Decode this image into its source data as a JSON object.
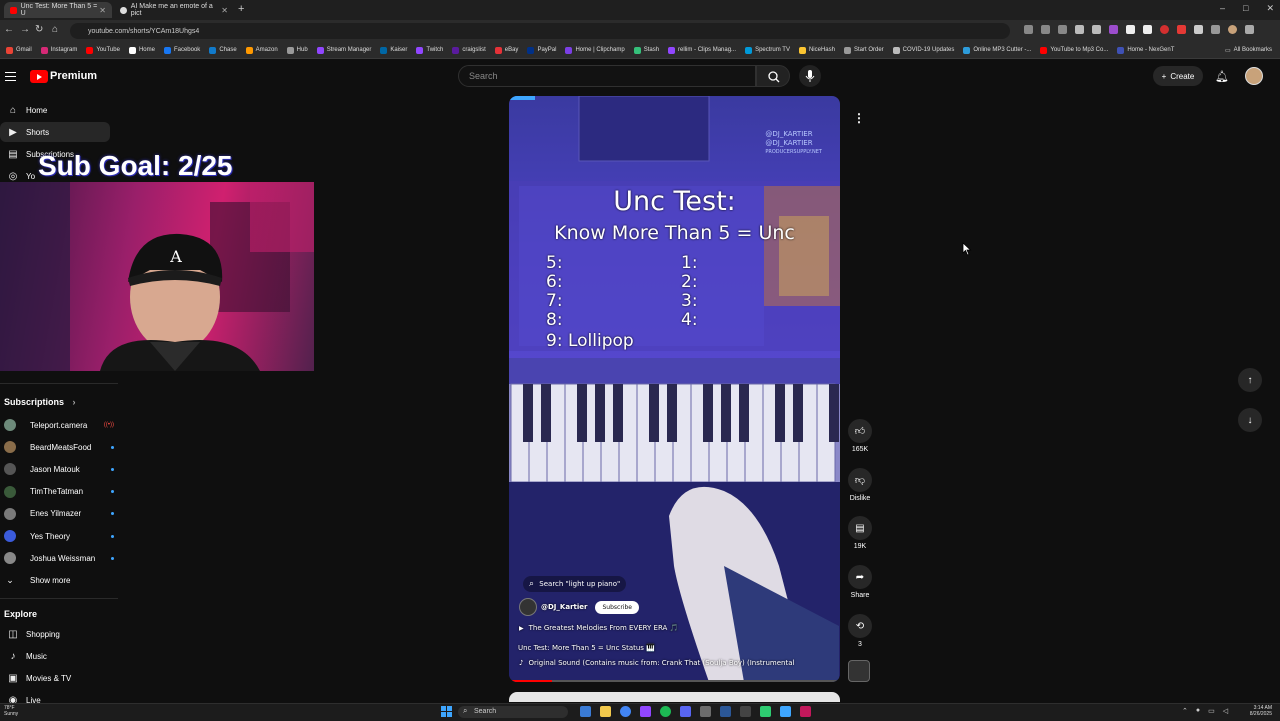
{
  "browser": {
    "tabs": [
      {
        "title": "Unc Test: More Than 5 = U"
      },
      {
        "title": "AI Make me an emote of a pict"
      }
    ],
    "url": "youtube.com/shorts/YCAm18Uhgs4",
    "window_controls": [
      "–",
      "□",
      "✕"
    ]
  },
  "bookmarks": [
    {
      "label": "Gmail",
      "color": "#ea4335"
    },
    {
      "label": "Instagram",
      "color": "#d62976"
    },
    {
      "label": "YouTube",
      "color": "#ff0000"
    },
    {
      "label": "Home",
      "color": "#ffffff"
    },
    {
      "label": "Facebook",
      "color": "#1877f2"
    },
    {
      "label": "Chase",
      "color": "#117aca"
    },
    {
      "label": "Amazon",
      "color": "#ff9900"
    },
    {
      "label": "Hub",
      "color": "#999999"
    },
    {
      "label": "Stream Manager",
      "color": "#9146ff"
    },
    {
      "label": "Kaiser",
      "color": "#0067a5"
    },
    {
      "label": "Twitch",
      "color": "#9146ff"
    },
    {
      "label": "craigslist",
      "color": "#5a1b9e"
    },
    {
      "label": "eBay",
      "color": "#e53238"
    },
    {
      "label": "PayPal",
      "color": "#003087"
    },
    {
      "label": "Home | Clipchamp",
      "color": "#7b3fe4"
    },
    {
      "label": "Stash",
      "color": "#35c07a"
    },
    {
      "label": "rellim - Clips Manag...",
      "color": "#9146ff"
    },
    {
      "label": "Spectrum TV",
      "color": "#0099d8"
    },
    {
      "label": "NiceHash",
      "color": "#fbc531"
    },
    {
      "label": "Start Order",
      "color": "#999999"
    },
    {
      "label": "COVID-19 Updates",
      "color": "#bbbbbb"
    },
    {
      "label": "Online MP3 Cutter -...",
      "color": "#2d9cdb"
    },
    {
      "label": "YouTube to Mp3 Co...",
      "color": "#ff0000"
    },
    {
      "label": "Home - NexGenT",
      "color": "#3f51b5"
    }
  ],
  "bookmarks_all": "All Bookmarks",
  "youtube": {
    "brand": "Premium",
    "search_placeholder": "Search",
    "create_label": "Create"
  },
  "sidebar": {
    "main": [
      {
        "label": "Home",
        "icon": "⌂"
      },
      {
        "label": "Shorts",
        "icon": "▶"
      },
      {
        "label": "Subscriptions",
        "icon": "▤"
      },
      {
        "label": "Yo",
        "icon": "◎"
      }
    ],
    "subscriptions_title": "Subscriptions",
    "subscriptions": [
      {
        "name": "Teleport.camera",
        "color": "#6d8a7a",
        "live": true
      },
      {
        "name": "BeardMeatsFood",
        "color": "#8a6d4a",
        "live": false
      },
      {
        "name": "Jason Matouk",
        "color": "#555555",
        "live": false
      },
      {
        "name": "TimTheTatman",
        "color": "#3a5a3a",
        "live": false
      },
      {
        "name": "Enes Yilmazer",
        "color": "#7a7a7a",
        "live": false
      },
      {
        "name": "Yes Theory",
        "color": "#3b5bdb",
        "live": false
      },
      {
        "name": "Joshua Weissman",
        "color": "#888888",
        "live": false
      }
    ],
    "show_more": "Show more",
    "explore_title": "Explore",
    "explore": [
      {
        "label": "Shopping",
        "icon": "◫"
      },
      {
        "label": "Music",
        "icon": "♪"
      },
      {
        "label": "Movies & TV",
        "icon": "▣"
      },
      {
        "label": "Live",
        "icon": "◉"
      }
    ]
  },
  "overlay": {
    "sub_goal": "Sub Goal: 2/25"
  },
  "short": {
    "watermark_line1": "@DJ_KARTIER",
    "watermark_line2": "@DJ_KARTIER",
    "watermark_line3": "PRODUCERSUPPLY.NET",
    "title_line1": "Unc Test:",
    "title_line2": "Know More Than 5 = Unc",
    "list_left": [
      "5:",
      "6:",
      "7:",
      "8:",
      "9: Lollipop"
    ],
    "list_right": [
      "1:",
      "2:",
      "3:",
      "4:"
    ],
    "search_chip": "Search \"light up piano\"",
    "channel": "@DJ_Kartier",
    "subscribe_label": "Subscribe",
    "playlist": "The Greatest Melodies From EVERY ERA 🎵",
    "caption": "Unc Test: More Than 5 = Unc Status 🎹",
    "sound": "Original Sound (Contains music from: Crank That (Soulja Boy) (Instrumental"
  },
  "controls": {
    "like_count": "165K",
    "dislike_label": "Dislike",
    "comments_count": "19K",
    "share_label": "Share",
    "remix_count": "3"
  },
  "taskbar": {
    "weather_temp": "78°F",
    "weather_desc": "Sunny",
    "search_label": "Search",
    "time": "3:14 AM",
    "date": "8/26/2025"
  }
}
